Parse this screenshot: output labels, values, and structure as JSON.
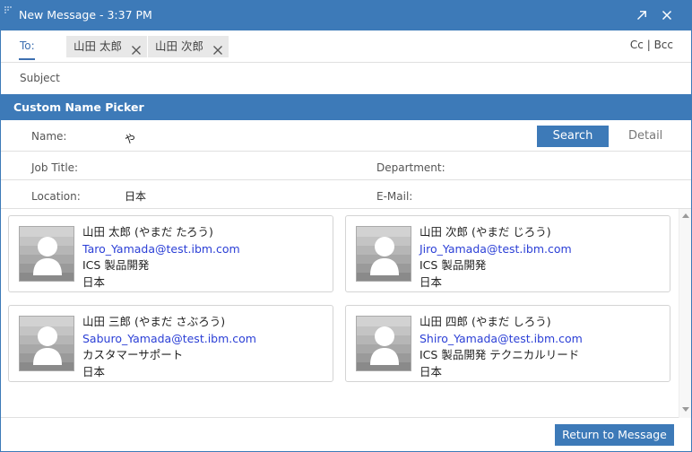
{
  "window": {
    "title": "New Message - 3:37 PM"
  },
  "to": {
    "label": "To:",
    "recipients": [
      "山田 太郎",
      "山田 次郎"
    ],
    "cc_bcc": "Cc | Bcc"
  },
  "subject": {
    "label": "Subject"
  },
  "picker": {
    "title": "Custom Name Picker",
    "name_label": "Name:",
    "name_value": "や",
    "search_label": "Search",
    "detail_label": "Detail",
    "job_title_label": "Job Title:",
    "department_label": "Department:",
    "location_label": "Location:",
    "location_value": "日本",
    "email_label": "E-Mail:"
  },
  "results": [
    {
      "name": "山田 太郎 (やまだ たろう)",
      "email": "Taro_Yamada@test.ibm.com",
      "department": "ICS 製品開発",
      "location": "日本"
    },
    {
      "name": "山田 次郎 (やまだ じろう)",
      "email": "Jiro_Yamada@test.ibm.com",
      "department": "ICS 製品開発",
      "location": "日本"
    },
    {
      "name": "山田 三郎 (やまだ さぶろう)",
      "email": "Saburo_Yamada@test.ibm.com",
      "department": "カスタマーサポート",
      "location": "日本"
    },
    {
      "name": "山田 四郎 (やまだ しろう)",
      "email": "Shiro_Yamada@test.ibm.com",
      "department": "ICS 製品開発 テクニカルリード",
      "location": "日本"
    }
  ],
  "footer": {
    "return_label": "Return to Message"
  },
  "colors": {
    "accent": "#3d7ab8",
    "link": "#2b3fd6",
    "chip_bg": "#e8e8e8"
  },
  "icons": [
    "drag-grip-icon",
    "popout-icon",
    "close-icon",
    "remove-recipient-icon",
    "person-placeholder-icon",
    "scroll-up-icon",
    "scroll-down-icon"
  ]
}
